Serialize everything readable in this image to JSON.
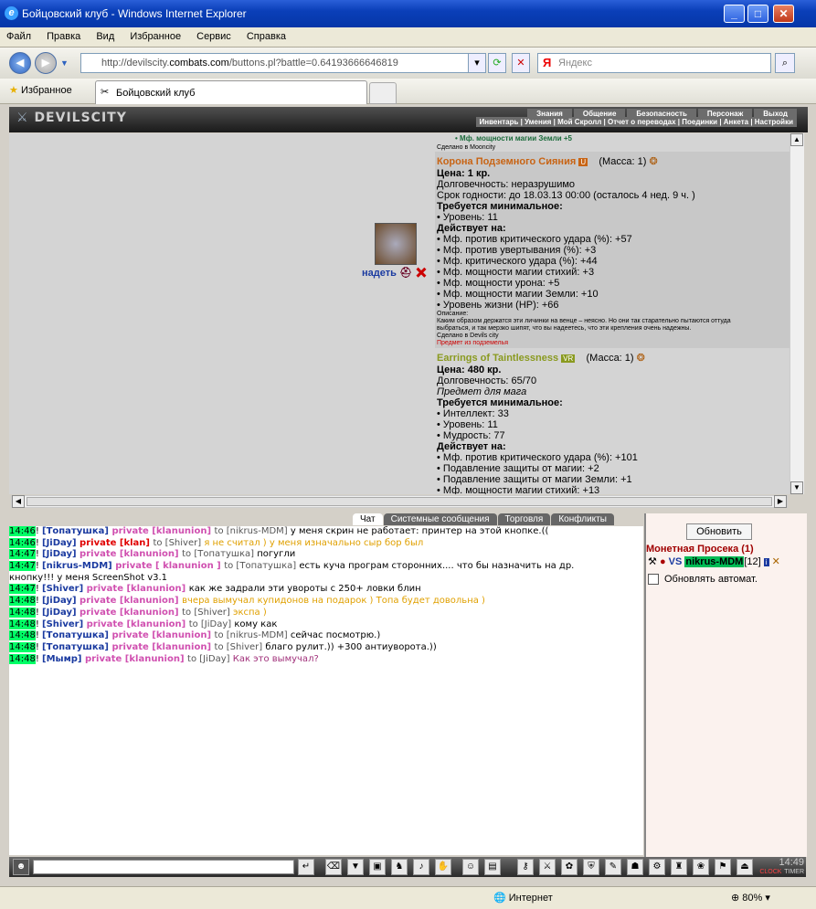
{
  "window": {
    "title": "Бойцовский клуб - Windows Internet Explorer"
  },
  "menu": [
    "Файл",
    "Правка",
    "Вид",
    "Избранное",
    "Сервис",
    "Справка"
  ],
  "address": {
    "url_prefix": "http://devilscity.",
    "url_domain": "combats.com",
    "url_rest": "/buttons.pl?battle=0.64193666646819",
    "search_placeholder": "Яндекс"
  },
  "favorites": {
    "label": "Избранное",
    "tab": "Бойцовский клуб"
  },
  "game_nav": {
    "row1": [
      "Знания",
      "Общение",
      "Безопасность",
      "Персонаж",
      "Выход"
    ],
    "row2": "Инвентарь | Умения | Мой Скролл | Отчет о переводах | Поединки | Анкета | Настройки",
    "logo": "DEVILSCITY"
  },
  "items": {
    "top_fragment": "• Мф. мощности магии Земли +5",
    "top_made": "Сделано в Mooncity",
    "item1": {
      "name": "Корона Подземного Сияния",
      "mass": "(Масса: 1)",
      "lines": [
        "Цена: 1 кр.",
        "Долговечность: неразрушимо",
        "Срок годности: до 18.03.13 00:00 (осталось 4 нед. 9 ч. )",
        "Требуется минимальное:",
        "• Уровень: 11",
        "Действует на:",
        "• Мф. против критического удара (%): +57",
        "• Мф. против увертывания (%): +3",
        "• Мф. критического удара (%): +44",
        "• Мф. мощности магии стихий: +3",
        "• Мф. мощности урона: +5",
        "• Мф. мощности магии Земли: +10",
        "• Уровень жизни (HP): +66"
      ],
      "desc_small": [
        "Описание:",
        "Каким образом держатся эти личинки на венце – неясно. Но они так старательно пытаются оттуда",
        "выбраться, и так мерзко шипят, что вы надеетесь, что эти крепления очень надежны.",
        "Сделано в Devils city"
      ],
      "foot": "Предмет из подземелья",
      "put_label": "надеть"
    },
    "item2": {
      "name": "Earrings of Taintlessness",
      "mass": "(Масса: 1)",
      "lines": [
        "Цена: 480 кр.",
        "Долговечность: 65/70",
        "Предмет для мага",
        "Требуется минимальное:",
        "• Интеллект: 33",
        "• Уровень: 11",
        "• Мудрость: 77",
        "Действует на:",
        "• Мф. против критического удара (%): +101",
        "• Подавление защиты от магии: +2",
        "• Подавление защиты от магии Земли: +1",
        "• Мф. мощности магии стихий: +13"
      ]
    }
  },
  "chat_tabs": [
    "Чат",
    "Системные сообщения",
    "Торговля",
    "Конфликты"
  ],
  "chat": [
    {
      "time": "14:46",
      "nick": "Топатушка",
      "priv": "private [klanunion]",
      "to": "to [nikrus-MDM]",
      "msg": "у меня скрин не работает: принтер на этой кнопке.(("
    },
    {
      "time": "14:46",
      "nick": "JiDay",
      "priv": "private [klan]",
      "to": "to [Shiver]",
      "msg": "я не считал ) у меня изначально сыр бор был"
    },
    {
      "time": "14:47",
      "nick": "JiDay",
      "priv": "private [klanunion]",
      "to": "to [Топатушка]",
      "msg": "погугли"
    },
    {
      "time": "14:47",
      "nick": "nikrus-MDM",
      "priv": "private [ klanunion ]",
      "to": "to [Топатушка]",
      "msg": "есть куча програм сторонних.... что бы назначить на др."
    },
    {
      "time": "",
      "nick": "",
      "priv": "",
      "to": "",
      "msg": "кнопку!!! у меня ScreenShot v3.1"
    },
    {
      "time": "14:47",
      "nick": "Shiver",
      "priv": "private [klanunion]",
      "to": "",
      "msg": "как же задрали эти увороты с 250+ ловки блин"
    },
    {
      "time": "14:48",
      "nick": "JiDay",
      "priv": "private [klanunion]",
      "to": "",
      "msg": "вчера вымучал купидонов на подарок ) Топа будет довольна )"
    },
    {
      "time": "14:48",
      "nick": "JiDay",
      "priv": "private [klanunion]",
      "to": "to [Shiver]",
      "msg": "экспа )"
    },
    {
      "time": "14:48",
      "nick": "Shiver",
      "priv": "private [klanunion]",
      "to": "to [JiDay]",
      "msg": "кому как"
    },
    {
      "time": "14:48",
      "nick": "Топатушка",
      "priv": "private [klanunion]",
      "to": "to [nikrus-MDM]",
      "msg": "сейчас посмотрю.)"
    },
    {
      "time": "14:48",
      "nick": "Топатушка",
      "priv": "private [klanunion]",
      "to": "to [Shiver]",
      "msg": "благо рулит.)) +300 антиуворота.))"
    },
    {
      "time": "14:48",
      "nick": "Мымр",
      "priv": "private [klanunion]",
      "to": "to [JiDay]",
      "msg": "Как это вымучал?"
    }
  ],
  "online": {
    "refresh": "Обновить",
    "location": "Монетная Просека (1)",
    "user": "nikrus-MDM",
    "level": "[12]",
    "auto": "Обновлять автомат."
  },
  "clock": {
    "time": "14:49",
    "label1": "CLOCK",
    "label2": "TIMER"
  },
  "status": {
    "zone": "Интернет",
    "zoom": "80%"
  }
}
